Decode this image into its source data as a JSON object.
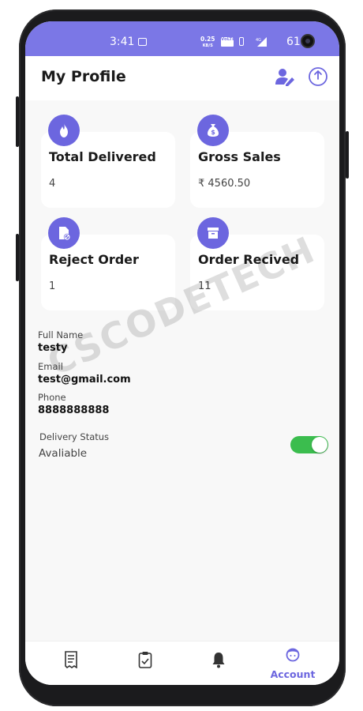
{
  "status_bar": {
    "time": "3:41",
    "net_speed": "0.25",
    "net_unit": "KB/S",
    "volte": "VoLTE",
    "signal": "4G",
    "battery": "61"
  },
  "header": {
    "title": "My Profile"
  },
  "stats": [
    {
      "label": "Total Delivered",
      "value": "4",
      "icon": "fire-icon"
    },
    {
      "label": "Gross Sales",
      "value": "₹ 4560.50",
      "icon": "money-bag-icon"
    },
    {
      "label": "Reject Order",
      "value": "1",
      "icon": "document-cancel-icon"
    },
    {
      "label": "Order Recived",
      "value": "11",
      "icon": "archive-box-icon"
    }
  ],
  "profile": {
    "full_name_label": "Full Name",
    "full_name": "testy",
    "email_label": "Email",
    "email": "test@gmail.com",
    "phone_label": "Phone",
    "phone": "8888888888",
    "delivery_status_label": "Delivery Status",
    "delivery_status": "Avaliable",
    "delivery_toggle_on": true
  },
  "watermark": "CSCODETECH",
  "bottom_nav": {
    "items": [
      {
        "icon": "receipt-icon",
        "label": ""
      },
      {
        "icon": "clipboard-check-icon",
        "label": ""
      },
      {
        "icon": "bell-icon",
        "label": ""
      },
      {
        "icon": "account-icon",
        "label": "Account"
      }
    ]
  },
  "colors": {
    "accent": "#6c66df",
    "status_bar": "#7b77e6",
    "toggle_on": "#3bbd4e"
  }
}
